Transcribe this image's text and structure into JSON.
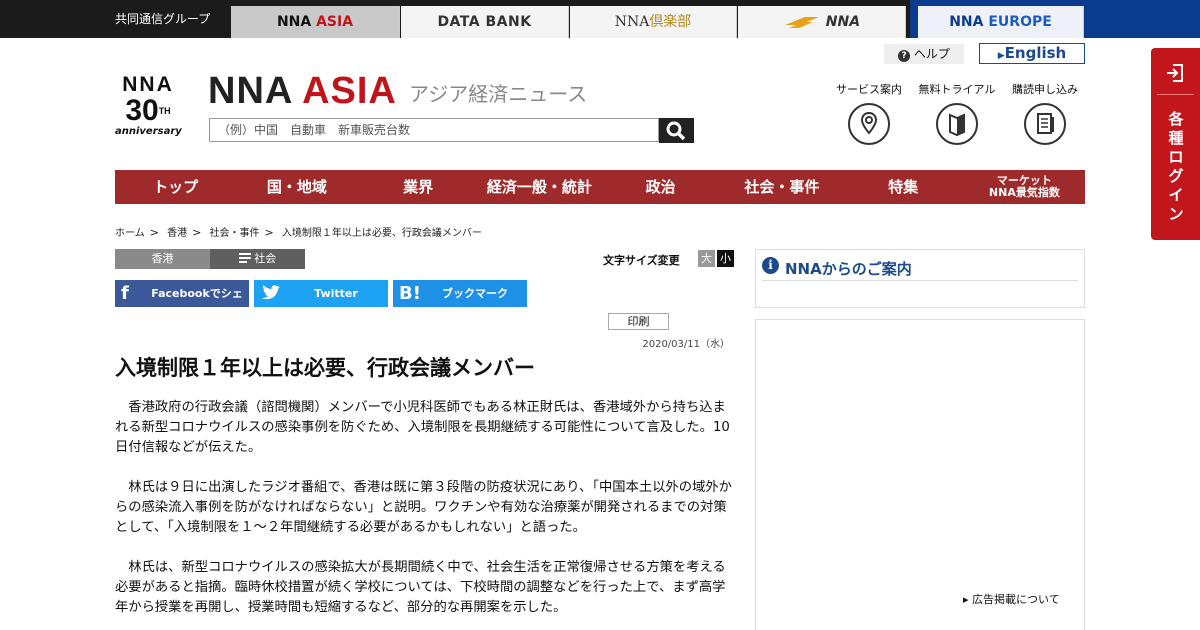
{
  "topbar": {
    "group_label": "共同通信グループ",
    "tabs": {
      "asia_a": "NNA",
      "asia_b": "ASIA",
      "databank": "DATA BANK",
      "club_a": "NNA",
      "club_b": "倶楽部",
      "nna": "NNA",
      "europe_a": "NNA",
      "europe_b": "EUROPE"
    }
  },
  "header": {
    "anniv_nna": "NNA",
    "anniv_num": "30",
    "anniv_th": "TH",
    "anniv_text": "anniversary",
    "brand_nna": "NNA",
    "brand_asia": "ASIA",
    "tagline": "アジア経済ニュース",
    "search_placeholder": "（例）中国　自動車　新車販売台数",
    "help": "ヘルプ",
    "english": "English",
    "services": [
      "サービス案内",
      "無料トライアル",
      "購読申し込み"
    ]
  },
  "login": {
    "label": "各種ログイン"
  },
  "nav": {
    "items": [
      "トップ",
      "国・地域",
      "業界",
      "経済一般・統計",
      "政治",
      "社会・事件",
      "特集"
    ],
    "market_line1": "マーケット",
    "market_line2": "NNA景気指数"
  },
  "breadcrumb": [
    "ホーム",
    "香港",
    "社会・事件",
    "入境制限１年以上は必要、行政会議メンバー"
  ],
  "article": {
    "region": "香港",
    "category": "社会",
    "font_size_label": "文字サイズ変更",
    "font_big": "大",
    "font_small": "小",
    "share": {
      "facebook": "Facebookでシェア",
      "twitter": "Twitter",
      "hatena": "ブックマーク"
    },
    "print": "印刷",
    "date": "2020/03/11（水）",
    "title": "入境制限１年以上は必要、行政会議メンバー",
    "paragraphs": [
      "香港政府の行政会議（諮問機関）メンバーで小児科医師でもある林正財氏は、香港域外から持ち込まれる新型コロナウイルスの感染事例を防ぐため、入境制限を長期継続する可能性について言及した。10日付信報などが伝えた。",
      "林氏は９日に出演したラジオ番組で、香港は既に第３段階の防疫状況にあり、「中国本土以外の域外からの感染流入事例を防がなければならない」と説明。ワクチンや有効な治療薬が開発されるまでの対策として、「入境制限を１～２年間継続する必要があるかもしれない」と語った。",
      "林氏は、新型コロナウイルスの感染拡大が長期間続く中で、社会生活を正常復帰させる方策を考える必要があると指摘。臨時休校措置が続く学校については、下校時間の調整などを行った上で、まず高学年から授業を再開し、授業時間も短縮するなど、部分的な再開案を示した。"
    ]
  },
  "sidebar": {
    "info_title": "NNAからのご案内",
    "ad_link": "▸ 広告掲載について"
  }
}
